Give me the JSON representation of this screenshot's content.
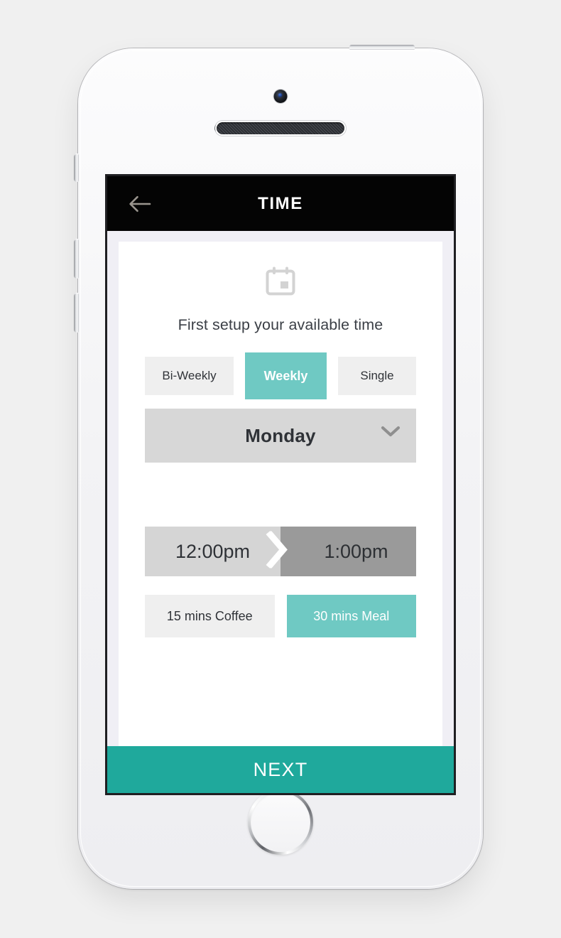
{
  "app": {
    "header": {
      "title": "TIME",
      "back_icon": "arrow-left-icon"
    },
    "card": {
      "hero_icon": "calendar-icon",
      "headline": "First setup your available time",
      "frequency": {
        "options": [
          {
            "label": "Bi-Weekly",
            "selected": false
          },
          {
            "label": "Weekly",
            "selected": true
          },
          {
            "label": "Single",
            "selected": false
          }
        ]
      },
      "day_select": {
        "value": "Monday",
        "chevron_icon": "chevron-down-icon"
      },
      "time_range": {
        "start": "12:00pm",
        "end": "1:00pm",
        "arrow_icon": "chevron-right-icon"
      },
      "duration": {
        "options": [
          {
            "label": "15 mins Coffee",
            "selected": false
          },
          {
            "label": "30 mins Meal",
            "selected": true
          }
        ]
      }
    },
    "footer": {
      "next_label": "NEXT"
    }
  },
  "colors": {
    "header_bg": "#040404",
    "screen_bg": "#f0eff5",
    "card_bg": "#ffffff",
    "accent_teal": "#6fc9c3",
    "next_teal": "#1fa99c",
    "chip_gray": "#efefef",
    "select_gray": "#d7d7d7",
    "time_start_gray": "#d5d5d5",
    "time_end_gray": "#9a9a9a",
    "text_dark": "#303338"
  }
}
